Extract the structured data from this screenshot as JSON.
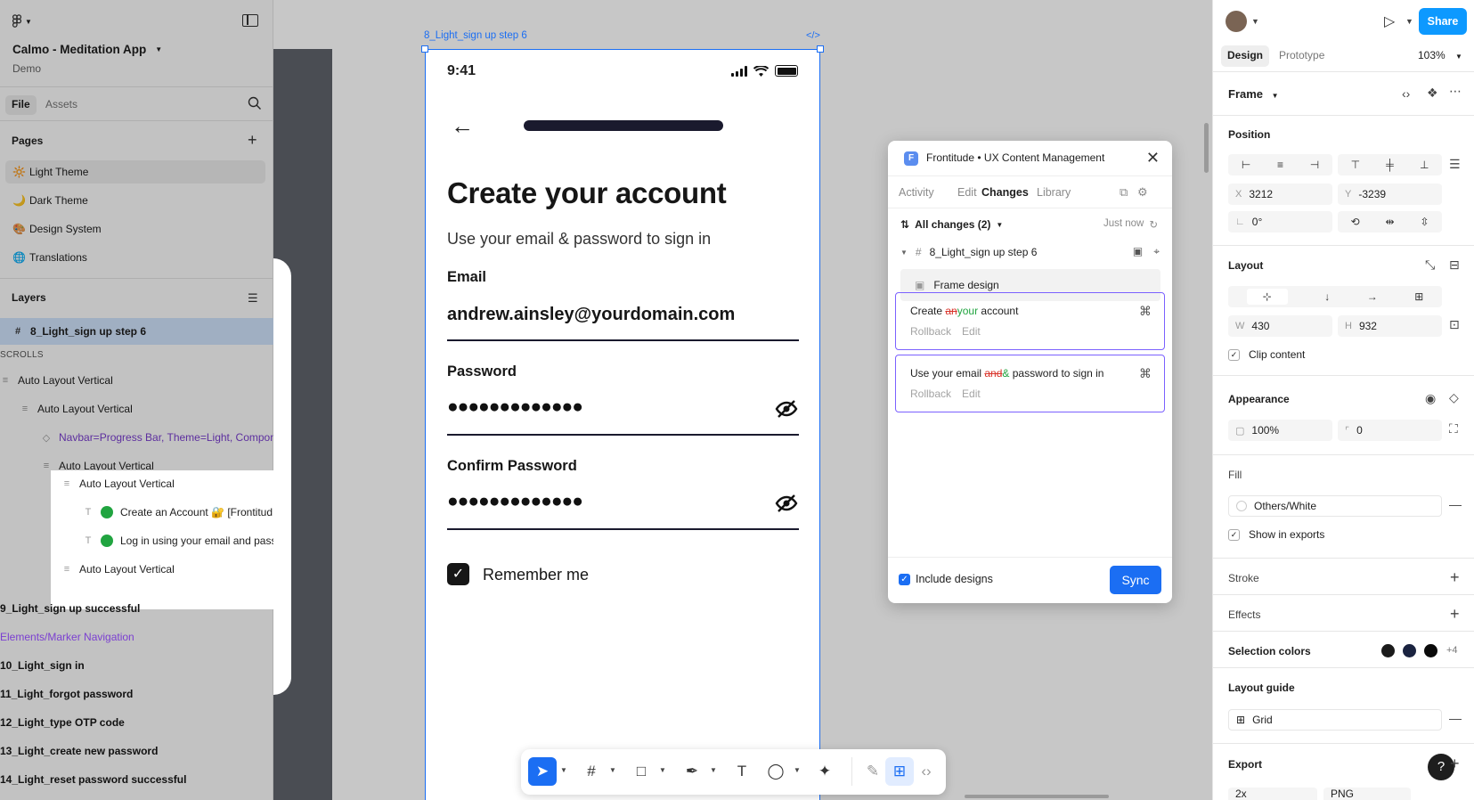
{
  "app": {
    "file_name": "Calmo - Meditation App",
    "team": "Demo"
  },
  "left_panel": {
    "tabs": [
      "File",
      "Assets"
    ],
    "pages_heading": "Pages",
    "pages": [
      {
        "emoji": "🔆",
        "label": "Light Theme",
        "active": true
      },
      {
        "emoji": "🌙",
        "label": "Dark Theme"
      },
      {
        "emoji": "🎨",
        "label": "Design System"
      },
      {
        "emoji": "🌐",
        "label": "Translations"
      }
    ],
    "layers_heading": "Layers",
    "layers": [
      {
        "label": "8_Light_sign up step 6",
        "icon": "#",
        "bold": true,
        "selected": true
      },
      {
        "label": "SCROLLS",
        "caption": true
      },
      {
        "label": "Auto Layout Vertical",
        "icon": "≡"
      },
      {
        "label": "Auto Layout Vertical",
        "icon": "≡"
      },
      {
        "label": "Navbar=Progress Bar, Theme=Light, Compon",
        "icon": "◇",
        "purple": true
      },
      {
        "label": "Auto Layout Vertical",
        "icon": "≡"
      },
      {
        "label": "Auto Layout Vertical",
        "icon": "≡"
      },
      {
        "label": "Create an Account 🔐 [Frontitud",
        "icon": "T",
        "dot": true
      },
      {
        "label": "Log in using your email and pass",
        "icon": "T",
        "dot": true
      },
      {
        "label": "Auto Layout Vertical",
        "icon": "≡"
      },
      {
        "label": "9_Light_sign up successful",
        "bold": true
      },
      {
        "label": "Elements/Marker Navigation",
        "purple": true
      },
      {
        "label": "10_Light_sign in",
        "bold": true
      },
      {
        "label": "11_Light_forgot password",
        "bold": true
      },
      {
        "label": "12_Light_type OTP code",
        "bold": true
      },
      {
        "label": "13_Light_create new password",
        "bold": true
      },
      {
        "label": "14_Light_reset password successful",
        "bold": true
      }
    ]
  },
  "canvas": {
    "frame_label": "8_Light_sign up step 6",
    "frame_code_icon": "</>",
    "phone": {
      "time": "9:41",
      "title": "Create your account",
      "subtitle": "Use your email & password to sign in",
      "email_label": "Email",
      "email_value": "andrew.ainsley@yourdomain.com",
      "password_label": "Password",
      "password_mask": "●●●●●●●●●●●●●",
      "confirm_label": "Confirm Password",
      "confirm_mask": "●●●●●●●●●●●●●",
      "remember": "Remember me"
    }
  },
  "plugin": {
    "title": "Frontitude • UX Content Management",
    "tabs": [
      "Activity",
      "Edit",
      "Changes",
      "Library"
    ],
    "active_tab": "Changes",
    "changes_label": "All changes (2)",
    "timestamp": "Just now",
    "tree_item": "8_Light_sign up step 6",
    "frame_design": "Frame design",
    "card1": {
      "pre": "Create ",
      "removed": "an",
      "added": "your",
      "post": " account"
    },
    "card2": {
      "pre": "Use your email ",
      "removed": "and",
      "added": "&",
      "post": " password to sign in"
    },
    "rollback": "Rollback",
    "edit": "Edit",
    "include_designs": "Include designs",
    "sync": "Sync"
  },
  "right_panel": {
    "share": "Share",
    "tabs": [
      "Design",
      "Prototype"
    ],
    "zoom": "103%",
    "frame": "Frame",
    "position_heading": "Position",
    "x_label": "X",
    "x": "3212",
    "y_label": "Y",
    "y": "-3239",
    "rotation": "0°",
    "layout_heading": "Layout",
    "w_label": "W",
    "w": "430",
    "h_label": "H",
    "h": "932",
    "clip_content": "Clip content",
    "appearance_heading": "Appearance",
    "opacity": "100%",
    "radius": "0",
    "fill_heading": "Fill",
    "fill_value": "Others/White",
    "show_in_exports": "Show in exports",
    "stroke_heading": "Stroke",
    "effects_heading": "Effects",
    "selection_colors_heading": "Selection colors",
    "selection_colors": [
      "#1b1b1b",
      "#1a2340",
      "#0a0a0a"
    ],
    "selection_more": "+4",
    "layout_guide_heading": "Layout guide",
    "grid": "Grid",
    "export_heading": "Export",
    "export_scale": "2x",
    "export_format": "PNG"
  },
  "colors": {
    "selection_blue": "#1b6ef3",
    "share_blue": "#0d99ff",
    "purple_component": "#7b3fd1"
  }
}
